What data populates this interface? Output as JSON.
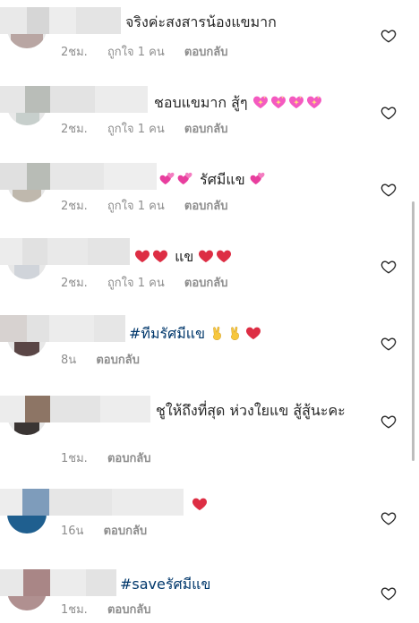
{
  "comments": [
    {
      "text": "จริงค่ะสงสารน้องแขมาก",
      "time": "2ชม.",
      "likes": "ถูกใจ 1 คน",
      "reply": "ตอบกลับ",
      "emoji_after": []
    },
    {
      "text": "ชอบแขมาก สู้ๆ",
      "time": "2ชม.",
      "likes": "ถูกใจ 1 คน",
      "reply": "ตอบกลับ",
      "emoji_after": [
        "sparkling-heart-icon",
        "sparkling-heart-icon",
        "sparkling-heart-icon",
        "sparkling-heart-icon"
      ]
    },
    {
      "text": "รัศมีแข",
      "time": "2ชม.",
      "likes": "ถูกใจ 1 คน",
      "reply": "ตอบกลับ",
      "emoji_before": [
        "two-hearts-icon",
        "two-hearts-icon"
      ],
      "emoji_after": [
        "two-hearts-icon"
      ]
    },
    {
      "text": "แข",
      "time": "2ชม.",
      "likes": "ถูกใจ 1 คน",
      "reply": "ตอบกลับ",
      "emoji_before": [
        "red-heart-icon",
        "red-heart-icon"
      ],
      "emoji_after": [
        "red-heart-icon",
        "red-heart-icon"
      ]
    },
    {
      "text": "#ทีมรัศมีแข",
      "time": "8น",
      "reply": "ตอบกลับ",
      "emoji_after": [
        "victory-hand-icon",
        "victory-hand-icon",
        "red-heart-icon"
      ]
    },
    {
      "text": "ชูให้ถึงที่สุด ห่วงใยแข สู้สู้นะคะ",
      "time": "1ชม.",
      "reply": "ตอบกลับ"
    },
    {
      "text": "",
      "time": "16น",
      "reply": "ตอบกลับ",
      "emoji_after": [
        "red-heart-icon"
      ]
    },
    {
      "text": "#saveรัศมีแข",
      "time": "1ชม.",
      "reply": "ตอบกลับ"
    }
  ],
  "colors": {
    "text": "#262626",
    "meta": "#8e8e8e",
    "hashtag": "#00376b",
    "red_heart": "#e0245e"
  }
}
